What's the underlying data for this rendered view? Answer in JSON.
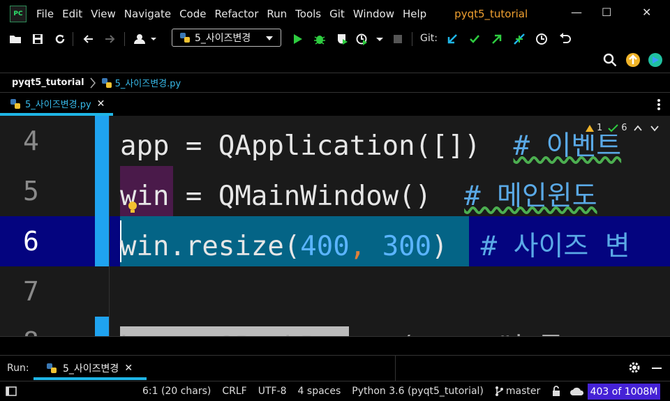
{
  "menubar": {
    "logo_text": "PC",
    "items": [
      "File",
      "Edit",
      "View",
      "Navigate",
      "Code",
      "Refactor",
      "Run",
      "Tools",
      "Git",
      "Window",
      "Help"
    ],
    "project_title": "pyqt5_tutorial",
    "minimize": "—",
    "maximize": "☐",
    "close": "✕"
  },
  "toolbar": {
    "run_config": "5_사이즈변경",
    "git_label": "Git:",
    "colors": {
      "run": "#2ecc40",
      "git_update": "#1fb5e6",
      "git_commit": "#2ecc40",
      "git_push": "#2ecc40"
    }
  },
  "navbar": {
    "project": "pyqt5_tutorial",
    "file": "5_사이즈변경.py"
  },
  "tabs": [
    {
      "label": "5_사이즈변경.py",
      "close": "✕"
    }
  ],
  "editor": {
    "inspections": {
      "warnings": "1",
      "ok": "6"
    },
    "lines": [
      {
        "no": "4"
      },
      {
        "no": "5"
      },
      {
        "no": "6"
      },
      {
        "no": "7"
      },
      {
        "no": "8"
      }
    ],
    "code": {
      "l4_code": "app = QApplication([])  ",
      "l4_comment": "# 이벤트",
      "l5_code": "win = QMainWindow()  ",
      "l5_comment": "# 메인윈도",
      "l6_a": "win.resize(",
      "l6_n1": "400",
      "l6_comma": ",",
      "l6_n2": "300",
      "l6_close": ")  ",
      "l6_comment": "# 사이즈 변",
      "l8_code": "btn = QPushButton(text=\"누르"
    }
  },
  "runtool": {
    "label": "Run:",
    "tab": "5_사이즈변경",
    "close": "✕"
  },
  "statusbar": {
    "position": "6:1 (20 chars)",
    "line_sep": "CRLF",
    "encoding": "UTF-8",
    "indent": "4 spaces",
    "interpreter": "Python 3.6 (pyqt5_tutorial)",
    "branch": "master",
    "memory": "403 of 1008M"
  }
}
